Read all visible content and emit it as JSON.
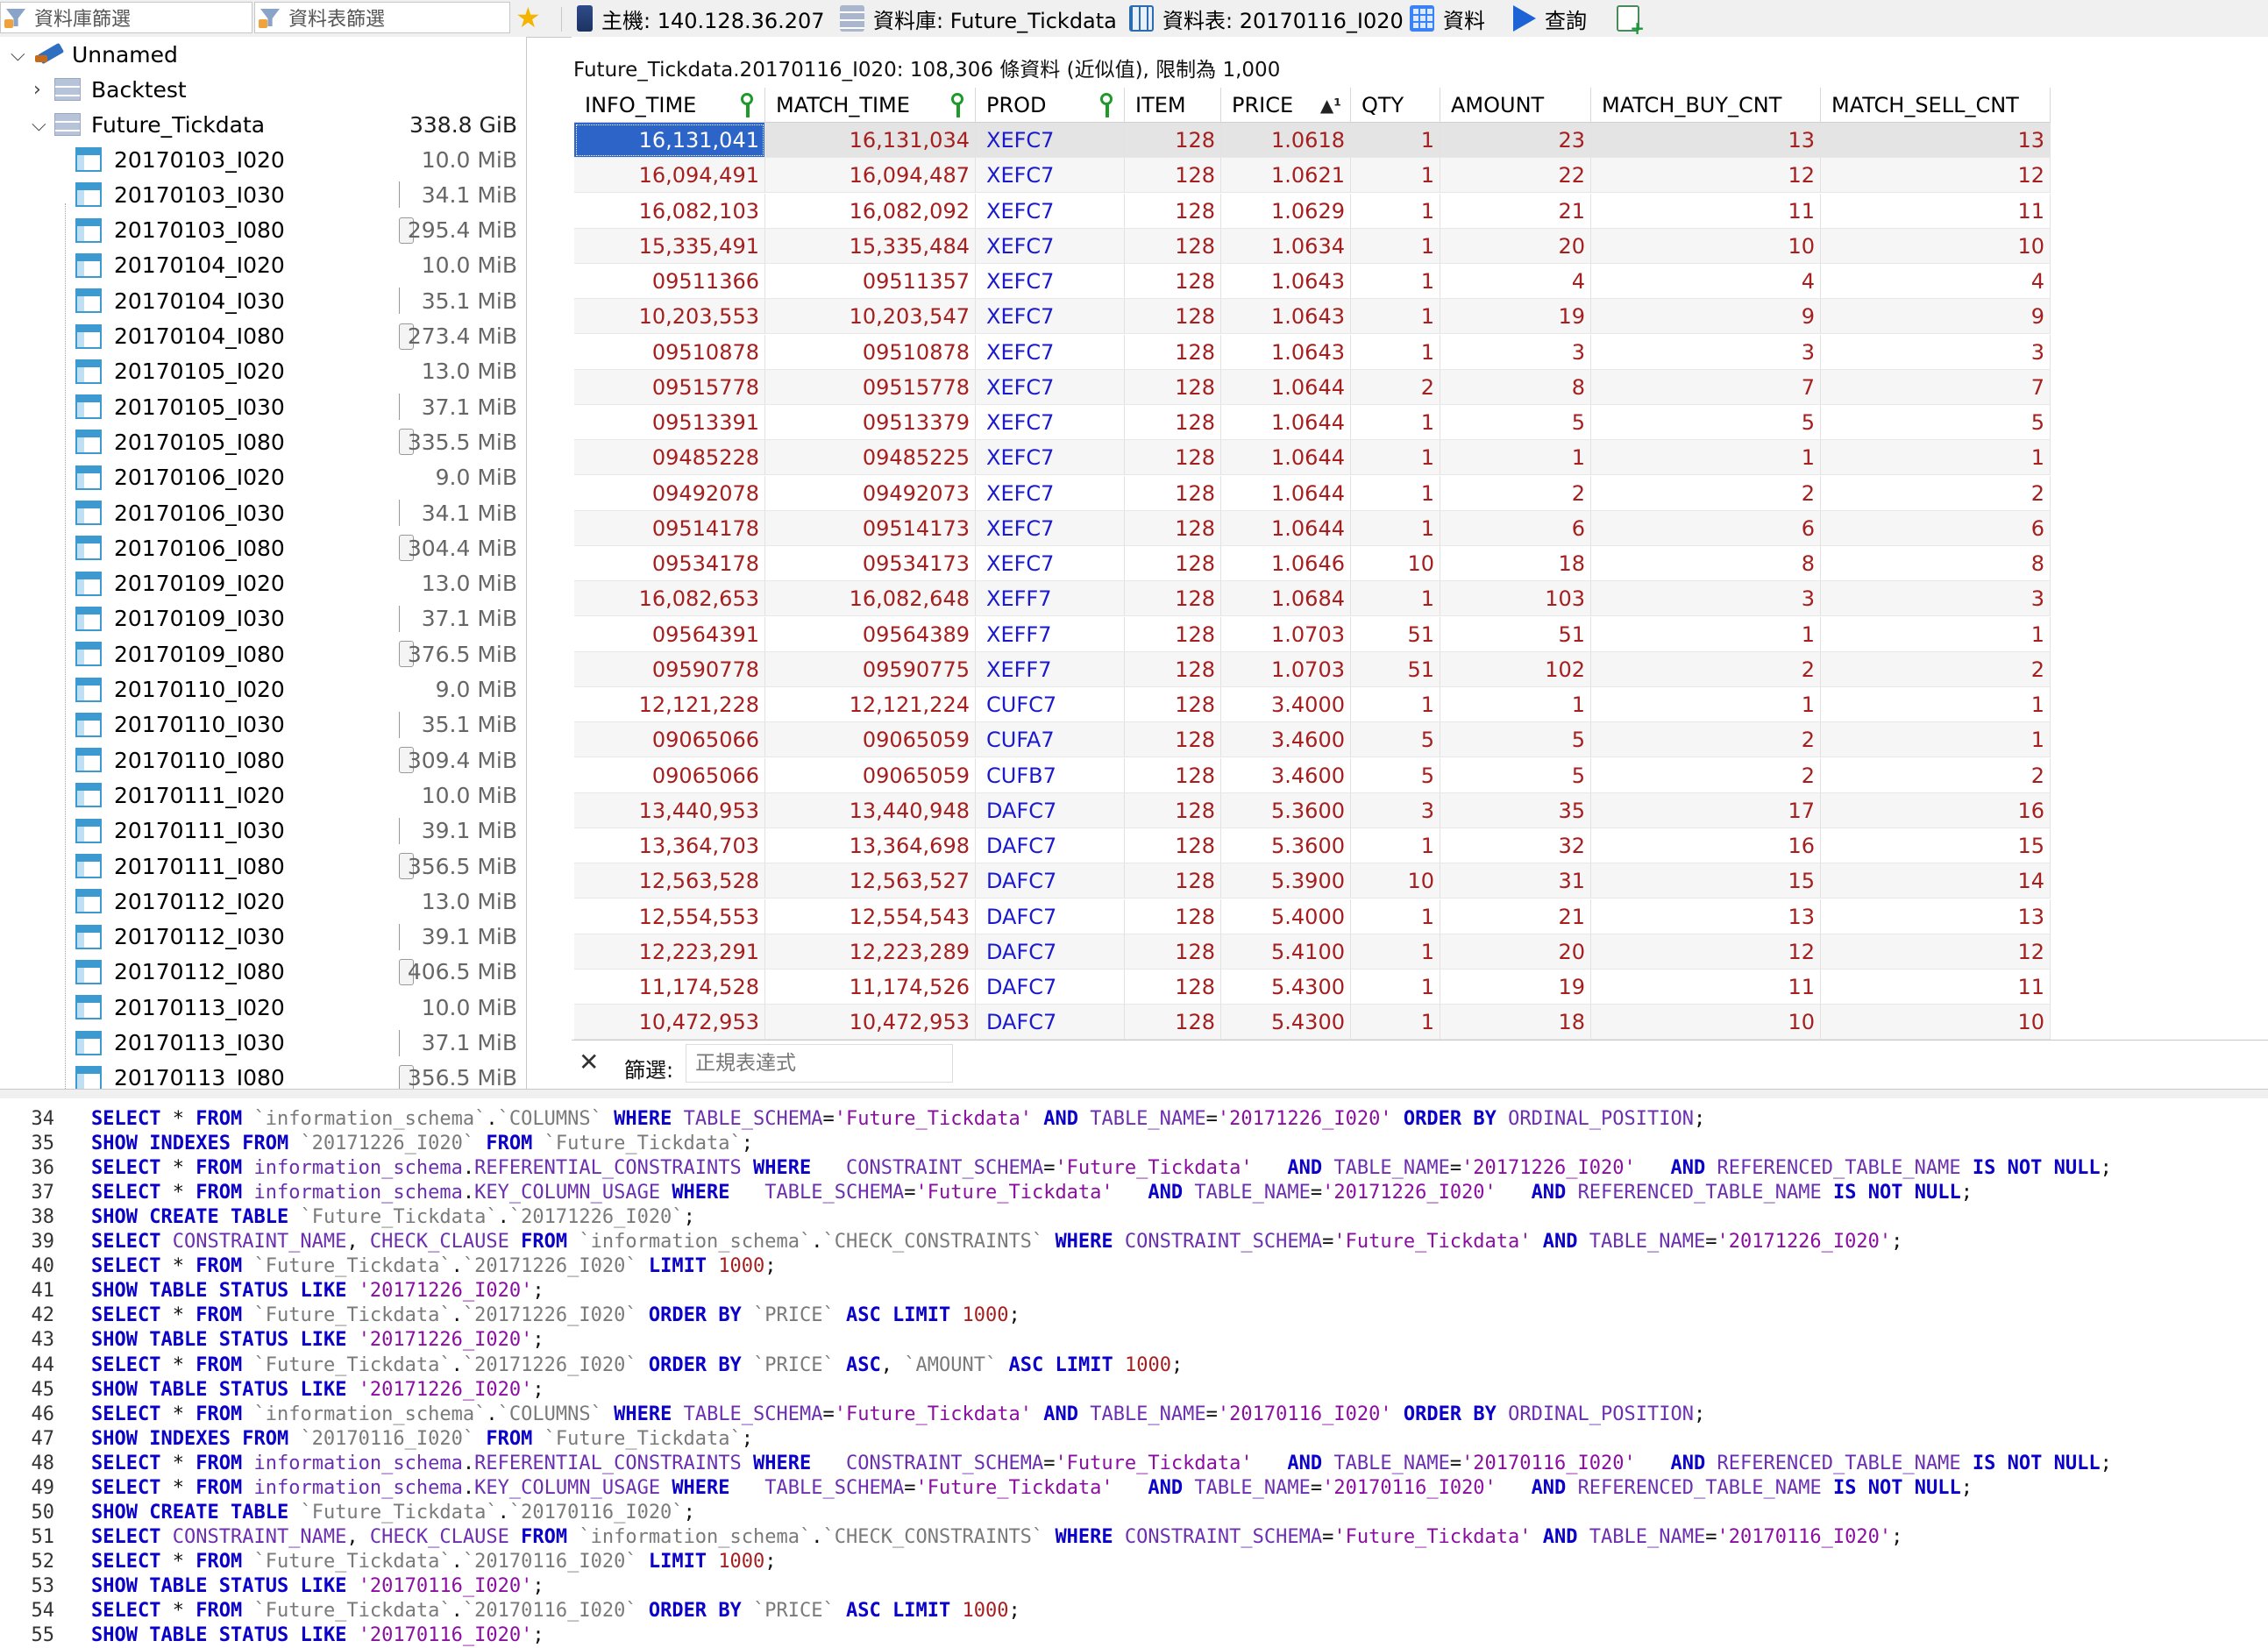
{
  "toolbar": {
    "db_filter_placeholder": "資料庫篩選",
    "table_filter_placeholder": "資料表篩選",
    "tabs": [
      {
        "label": "主機: 140.128.36.207",
        "icon": "server-icon"
      },
      {
        "label": "資料庫: Future_Tickdata",
        "icon": "database-icon"
      },
      {
        "label": "資料表: 20170116_I020",
        "icon": "table-icon"
      },
      {
        "label": "資料",
        "icon": "data-grid-icon"
      },
      {
        "label": "查詢",
        "icon": "play-icon"
      }
    ]
  },
  "tree": {
    "connection": "Unnamed",
    "databases": [
      {
        "name": "Backtest",
        "size": ""
      },
      {
        "name": "Future_Tickdata",
        "size": "338.8 GiB"
      }
    ],
    "tables": [
      {
        "name": "20170103_I020",
        "size": "10.0 MiB",
        "bar": "none"
      },
      {
        "name": "20170103_I030",
        "size": "34.1 MiB",
        "bar": "line"
      },
      {
        "name": "20170103_I080",
        "size": "295.4 MiB",
        "bar": "box"
      },
      {
        "name": "20170104_I020",
        "size": "10.0 MiB",
        "bar": "none"
      },
      {
        "name": "20170104_I030",
        "size": "35.1 MiB",
        "bar": "line"
      },
      {
        "name": "20170104_I080",
        "size": "273.4 MiB",
        "bar": "box"
      },
      {
        "name": "20170105_I020",
        "size": "13.0 MiB",
        "bar": "none"
      },
      {
        "name": "20170105_I030",
        "size": "37.1 MiB",
        "bar": "line"
      },
      {
        "name": "20170105_I080",
        "size": "335.5 MiB",
        "bar": "box"
      },
      {
        "name": "20170106_I020",
        "size": "9.0 MiB",
        "bar": "none"
      },
      {
        "name": "20170106_I030",
        "size": "34.1 MiB",
        "bar": "line"
      },
      {
        "name": "20170106_I080",
        "size": "304.4 MiB",
        "bar": "box"
      },
      {
        "name": "20170109_I020",
        "size": "13.0 MiB",
        "bar": "none"
      },
      {
        "name": "20170109_I030",
        "size": "37.1 MiB",
        "bar": "line"
      },
      {
        "name": "20170109_I080",
        "size": "376.5 MiB",
        "bar": "box"
      },
      {
        "name": "20170110_I020",
        "size": "9.0 MiB",
        "bar": "none"
      },
      {
        "name": "20170110_I030",
        "size": "35.1 MiB",
        "bar": "line"
      },
      {
        "name": "20170110_I080",
        "size": "309.4 MiB",
        "bar": "box"
      },
      {
        "name": "20170111_I020",
        "size": "10.0 MiB",
        "bar": "none"
      },
      {
        "name": "20170111_I030",
        "size": "39.1 MiB",
        "bar": "line"
      },
      {
        "name": "20170111_I080",
        "size": "356.5 MiB",
        "bar": "box"
      },
      {
        "name": "20170112_I020",
        "size": "13.0 MiB",
        "bar": "none"
      },
      {
        "name": "20170112_I030",
        "size": "39.1 MiB",
        "bar": "line"
      },
      {
        "name": "20170112_I080",
        "size": "406.5 MiB",
        "bar": "box"
      },
      {
        "name": "20170113_I020",
        "size": "10.0 MiB",
        "bar": "none"
      },
      {
        "name": "20170113_I030",
        "size": "37.1 MiB",
        "bar": "line"
      },
      {
        "name": "20170113_I080",
        "size": "356.5 MiB",
        "bar": "box"
      }
    ]
  },
  "grid": {
    "info": "Future_Tickdata.20170116_I020: 108,306 條資料 (近似值), 限制為 1,000",
    "columns": [
      {
        "label": "INFO_TIME",
        "align": "num",
        "key": true,
        "sort": false
      },
      {
        "label": "MATCH_TIME",
        "align": "num",
        "key": true,
        "sort": false
      },
      {
        "label": "PROD",
        "align": "txt",
        "key": true,
        "sort": false
      },
      {
        "label": "ITEM",
        "align": "num",
        "key": false,
        "sort": false
      },
      {
        "label": "PRICE",
        "align": "num",
        "key": false,
        "sort": true
      },
      {
        "label": "QTY",
        "align": "num",
        "key": false,
        "sort": false
      },
      {
        "label": "AMOUNT",
        "align": "num",
        "key": false,
        "sort": false
      },
      {
        "label": "MATCH_BUY_CNT",
        "align": "num",
        "key": false,
        "sort": false
      },
      {
        "label": "MATCH_SELL_CNT",
        "align": "num",
        "key": false,
        "sort": false
      }
    ],
    "rows": [
      [
        "16,131,041",
        "16,131,034",
        "XEFC7",
        "128",
        "1.0618",
        "1",
        "23",
        "13",
        "13"
      ],
      [
        "16,094,491",
        "16,094,487",
        "XEFC7",
        "128",
        "1.0621",
        "1",
        "22",
        "12",
        "12"
      ],
      [
        "16,082,103",
        "16,082,092",
        "XEFC7",
        "128",
        "1.0629",
        "1",
        "21",
        "11",
        "11"
      ],
      [
        "15,335,491",
        "15,335,484",
        "XEFC7",
        "128",
        "1.0634",
        "1",
        "20",
        "10",
        "10"
      ],
      [
        "09511366",
        "09511357",
        "XEFC7",
        "128",
        "1.0643",
        "1",
        "4",
        "4",
        "4"
      ],
      [
        "10,203,553",
        "10,203,547",
        "XEFC7",
        "128",
        "1.0643",
        "1",
        "19",
        "9",
        "9"
      ],
      [
        "09510878",
        "09510878",
        "XEFC7",
        "128",
        "1.0643",
        "1",
        "3",
        "3",
        "3"
      ],
      [
        "09515778",
        "09515778",
        "XEFC7",
        "128",
        "1.0644",
        "2",
        "8",
        "7",
        "7"
      ],
      [
        "09513391",
        "09513379",
        "XEFC7",
        "128",
        "1.0644",
        "1",
        "5",
        "5",
        "5"
      ],
      [
        "09485228",
        "09485225",
        "XEFC7",
        "128",
        "1.0644",
        "1",
        "1",
        "1",
        "1"
      ],
      [
        "09492078",
        "09492073",
        "XEFC7",
        "128",
        "1.0644",
        "1",
        "2",
        "2",
        "2"
      ],
      [
        "09514178",
        "09514173",
        "XEFC7",
        "128",
        "1.0644",
        "1",
        "6",
        "6",
        "6"
      ],
      [
        "09534178",
        "09534173",
        "XEFC7",
        "128",
        "1.0646",
        "10",
        "18",
        "8",
        "8"
      ],
      [
        "16,082,653",
        "16,082,648",
        "XEFF7",
        "128",
        "1.0684",
        "1",
        "103",
        "3",
        "3"
      ],
      [
        "09564391",
        "09564389",
        "XEFF7",
        "128",
        "1.0703",
        "51",
        "51",
        "1",
        "1"
      ],
      [
        "09590778",
        "09590775",
        "XEFF7",
        "128",
        "1.0703",
        "51",
        "102",
        "2",
        "2"
      ],
      [
        "12,121,228",
        "12,121,224",
        "CUFC7",
        "128",
        "3.4000",
        "1",
        "1",
        "1",
        "1"
      ],
      [
        "09065066",
        "09065059",
        "CUFA7",
        "128",
        "3.4600",
        "5",
        "5",
        "2",
        "1"
      ],
      [
        "09065066",
        "09065059",
        "CUFB7",
        "128",
        "3.4600",
        "5",
        "5",
        "2",
        "2"
      ],
      [
        "13,440,953",
        "13,440,948",
        "DAFC7",
        "128",
        "5.3600",
        "3",
        "35",
        "17",
        "16"
      ],
      [
        "13,364,703",
        "13,364,698",
        "DAFC7",
        "128",
        "5.3600",
        "1",
        "32",
        "16",
        "15"
      ],
      [
        "12,563,528",
        "12,563,527",
        "DAFC7",
        "128",
        "5.3900",
        "10",
        "31",
        "15",
        "14"
      ],
      [
        "12,554,553",
        "12,554,543",
        "DAFC7",
        "128",
        "5.4000",
        "1",
        "21",
        "13",
        "13"
      ],
      [
        "12,223,291",
        "12,223,289",
        "DAFC7",
        "128",
        "5.4100",
        "1",
        "20",
        "12",
        "12"
      ],
      [
        "11,174,528",
        "11,174,526",
        "DAFC7",
        "128",
        "5.4300",
        "1",
        "19",
        "11",
        "11"
      ],
      [
        "10,472,953",
        "10,472,953",
        "DAFC7",
        "128",
        "5.4300",
        "1",
        "18",
        "10",
        "10"
      ]
    ]
  },
  "filter": {
    "label": "篩選:",
    "placeholder": "正規表達式"
  },
  "sql_log": [
    {
      "n": "34",
      "t": "SELECT * FROM `information_schema`.`COLUMNS` WHERE TABLE_SCHEMA='Future_Tickdata' AND TABLE_NAME='20171226_I020' ORDER BY ORDINAL_POSITION;"
    },
    {
      "n": "35",
      "t": "SHOW INDEXES FROM `20171226_I020` FROM `Future_Tickdata`;"
    },
    {
      "n": "36",
      "t": "SELECT * FROM information_schema.REFERENTIAL_CONSTRAINTS WHERE   CONSTRAINT_SCHEMA='Future_Tickdata'   AND TABLE_NAME='20171226_I020'   AND REFERENCED_TABLE_NAME IS NOT NULL;"
    },
    {
      "n": "37",
      "t": "SELECT * FROM information_schema.KEY_COLUMN_USAGE WHERE   TABLE_SCHEMA='Future_Tickdata'   AND TABLE_NAME='20171226_I020'   AND REFERENCED_TABLE_NAME IS NOT NULL;"
    },
    {
      "n": "38",
      "t": "SHOW CREATE TABLE `Future_Tickdata`.`20171226_I020`;"
    },
    {
      "n": "39",
      "t": "SELECT CONSTRAINT_NAME, CHECK_CLAUSE FROM `information_schema`.`CHECK_CONSTRAINTS` WHERE CONSTRAINT_SCHEMA='Future_Tickdata' AND TABLE_NAME='20171226_I020';"
    },
    {
      "n": "40",
      "t": "SELECT * FROM `Future_Tickdata`.`20171226_I020` LIMIT 1000;"
    },
    {
      "n": "41",
      "t": "SHOW TABLE STATUS LIKE '20171226_I020';"
    },
    {
      "n": "42",
      "t": "SELECT * FROM `Future_Tickdata`.`20171226_I020` ORDER BY `PRICE` ASC LIMIT 1000;"
    },
    {
      "n": "43",
      "t": "SHOW TABLE STATUS LIKE '20171226_I020';"
    },
    {
      "n": "44",
      "t": "SELECT * FROM `Future_Tickdata`.`20171226_I020` ORDER BY `PRICE` ASC, `AMOUNT` ASC LIMIT 1000;"
    },
    {
      "n": "45",
      "t": "SHOW TABLE STATUS LIKE '20171226_I020';"
    },
    {
      "n": "46",
      "t": "SELECT * FROM `information_schema`.`COLUMNS` WHERE TABLE_SCHEMA='Future_Tickdata' AND TABLE_NAME='20170116_I020' ORDER BY ORDINAL_POSITION;"
    },
    {
      "n": "47",
      "t": "SHOW INDEXES FROM `20170116_I020` FROM `Future_Tickdata`;"
    },
    {
      "n": "48",
      "t": "SELECT * FROM information_schema.REFERENTIAL_CONSTRAINTS WHERE   CONSTRAINT_SCHEMA='Future_Tickdata'   AND TABLE_NAME='20170116_I020'   AND REFERENCED_TABLE_NAME IS NOT NULL;"
    },
    {
      "n": "49",
      "t": "SELECT * FROM information_schema.KEY_COLUMN_USAGE WHERE   TABLE_SCHEMA='Future_Tickdata'   AND TABLE_NAME='20170116_I020'   AND REFERENCED_TABLE_NAME IS NOT NULL;"
    },
    {
      "n": "50",
      "t": "SHOW CREATE TABLE `Future_Tickdata`.`20170116_I020`;"
    },
    {
      "n": "51",
      "t": "SELECT CONSTRAINT_NAME, CHECK_CLAUSE FROM `information_schema`.`CHECK_CONSTRAINTS` WHERE CONSTRAINT_SCHEMA='Future_Tickdata' AND TABLE_NAME='20170116_I020';"
    },
    {
      "n": "52",
      "t": "SELECT * FROM `Future_Tickdata`.`20170116_I020` LIMIT 1000;"
    },
    {
      "n": "53",
      "t": "SHOW TABLE STATUS LIKE '20170116_I020';"
    },
    {
      "n": "54",
      "t": "SELECT * FROM `Future_Tickdata`.`20170116_I020` ORDER BY `PRICE` ASC LIMIT 1000;"
    },
    {
      "n": "55",
      "t": "SHOW TABLE STATUS LIKE '20170116_I020';"
    }
  ],
  "colors": {
    "selection": "#2d64c8",
    "cell_text": "#1a1acc",
    "sql_keyword": "#0b00c8",
    "sql_string": "#8a0fa0"
  }
}
